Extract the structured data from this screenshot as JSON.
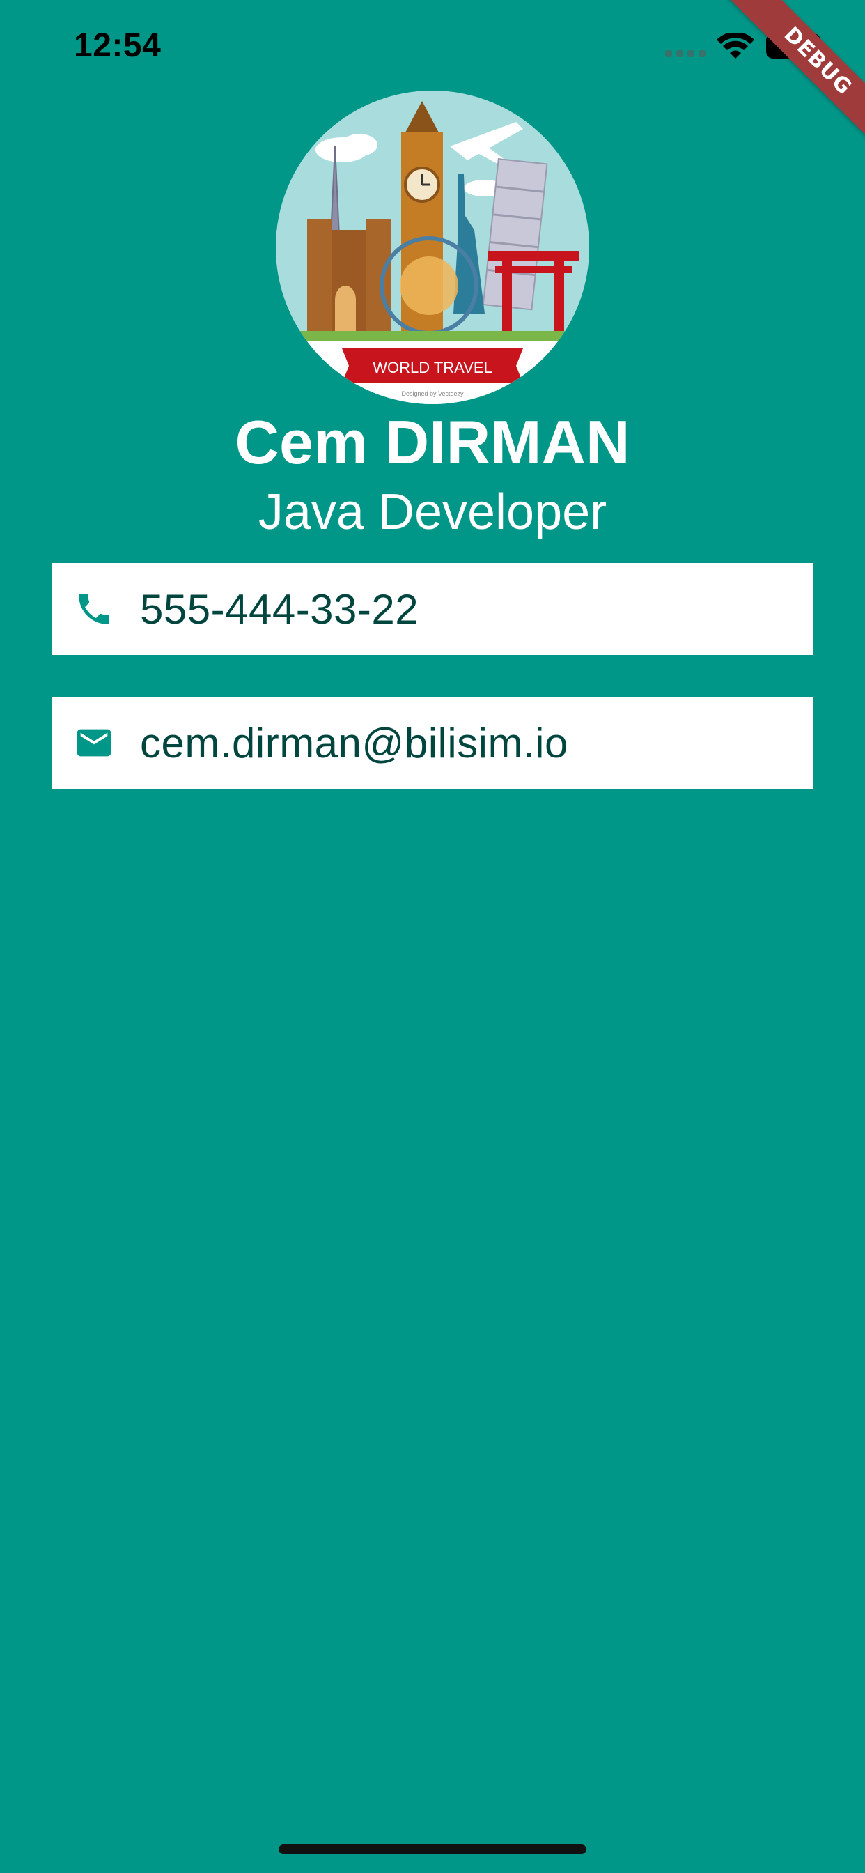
{
  "status_bar": {
    "time": "12:54"
  },
  "debug_banner": "DEBUG",
  "avatar": {
    "banner_text": "WORLD TRAVEL",
    "credit_text": "Designed by Vecteezy"
  },
  "profile": {
    "name": "Cem DIRMAN",
    "title": "Java Developer"
  },
  "contacts": {
    "phone": "555-444-33-22",
    "email": "cem.dirman@bilisim.io"
  },
  "colors": {
    "background": "#009688",
    "card": "#ffffff",
    "card_text": "#00463f",
    "icon": "#009688"
  },
  "icons": {
    "phone": "phone-icon",
    "email": "mail-icon"
  }
}
